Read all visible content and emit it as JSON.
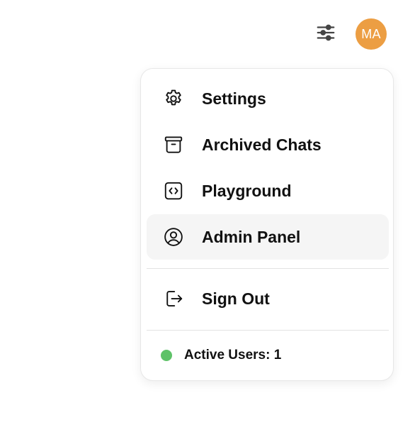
{
  "header": {
    "controls_icon": "sliders-icon",
    "avatar_initials": "MA",
    "avatar_color": "#ec9e43"
  },
  "menu": {
    "items": [
      {
        "label": "Settings",
        "icon": "gear-icon"
      },
      {
        "label": "Archived Chats",
        "icon": "archive-box-icon"
      },
      {
        "label": "Playground",
        "icon": "code-brackets-icon"
      },
      {
        "label": "Admin Panel",
        "icon": "user-circle-icon",
        "highlighted": true
      },
      {
        "label": "Sign Out",
        "icon": "sign-out-icon"
      }
    ],
    "status": {
      "label": "Active Users: 1",
      "dot_color": "#5ec268"
    }
  }
}
